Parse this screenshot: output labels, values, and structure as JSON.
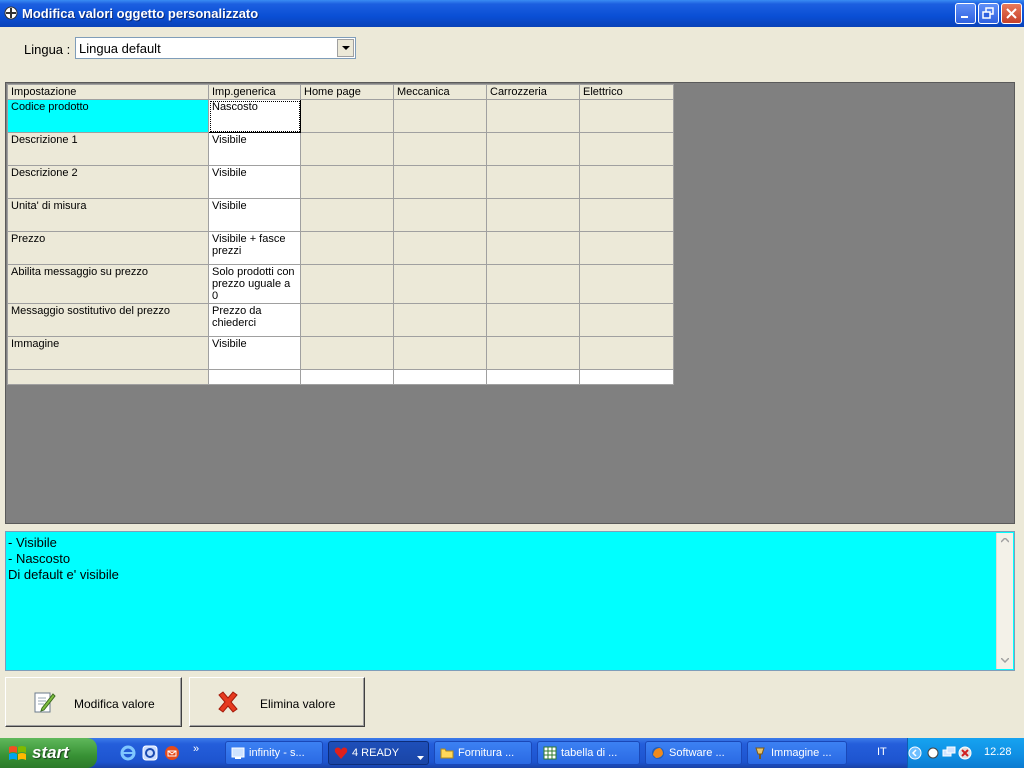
{
  "window": {
    "title": "Modifica valori oggetto personalizzato"
  },
  "language": {
    "label": "Lingua :",
    "selected": "Lingua default"
  },
  "grid": {
    "columns": [
      "Impostazione",
      "Imp.generica",
      "Home page",
      "Meccanica",
      "Carrozzeria",
      "Elettrico"
    ],
    "rows": [
      {
        "setting": "Codice prodotto",
        "generic": "Nascosto"
      },
      {
        "setting": "Descrizione 1",
        "generic": "Visibile"
      },
      {
        "setting": "Descrizione 2",
        "generic": "Visibile"
      },
      {
        "setting": "Unita' di misura",
        "generic": "Visibile"
      },
      {
        "setting": "Prezzo",
        "generic": "Visibile + fasce prezzi"
      },
      {
        "setting": "Abilita messaggio su prezzo",
        "generic": "Solo prodotti con prezzo uguale a 0"
      },
      {
        "setting": "Messaggio sostitutivo del prezzo",
        "generic": "Prezzo da chiederci"
      },
      {
        "setting": "Immagine",
        "generic": "Visibile"
      }
    ]
  },
  "description": {
    "lines": [
      "- Visibile",
      "- Nascosto",
      "Di default e' visibile"
    ]
  },
  "buttons": {
    "edit_label": "Modifica valore",
    "delete_label": "Elimina valore"
  },
  "taskbar": {
    "start_label": "start",
    "tasks": [
      {
        "label": "infinity - s...",
        "icon": "network-icon"
      },
      {
        "label": "4 READY",
        "icon": "heart-icon"
      },
      {
        "label": "Fornitura ...",
        "icon": "folder-icon"
      },
      {
        "label": "tabella di ...",
        "icon": "spreadsheet-icon"
      },
      {
        "label": "Software ...",
        "icon": "firefox-icon"
      },
      {
        "label": "Immagine ...",
        "icon": "paint-icon"
      }
    ],
    "language_indicator": "IT",
    "clock": "12.28"
  },
  "colors": {
    "selection": "#00ffff",
    "titlebar": "#0a4fd5",
    "panel": "#808080"
  }
}
